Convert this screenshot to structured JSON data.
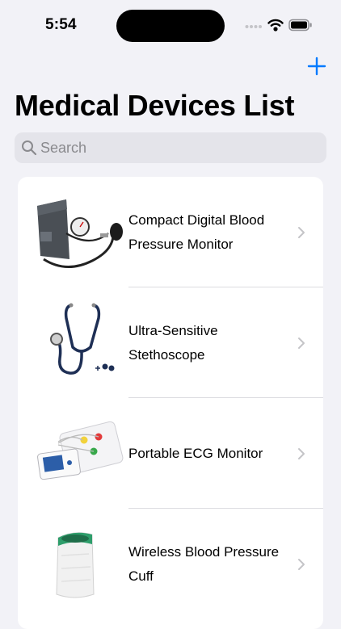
{
  "status_bar": {
    "time": "5:54"
  },
  "navigation": {
    "title": "Medical Devices List",
    "add_icon": "plus-icon"
  },
  "search": {
    "placeholder": "Search",
    "value": "",
    "icon": "magnifying-glass-icon"
  },
  "devices": [
    {
      "name": "Compact Digital Blood Pressure Monitor"
    },
    {
      "name": "Ultra-Sensitive Stethoscope"
    },
    {
      "name": "Portable ECG Monitor"
    },
    {
      "name": "Wireless Blood Pressure Cuff"
    }
  ],
  "colors": {
    "accent": "#007aff",
    "background": "#f2f2f7",
    "card": "#ffffff",
    "search_field": "#e4e4ea"
  }
}
